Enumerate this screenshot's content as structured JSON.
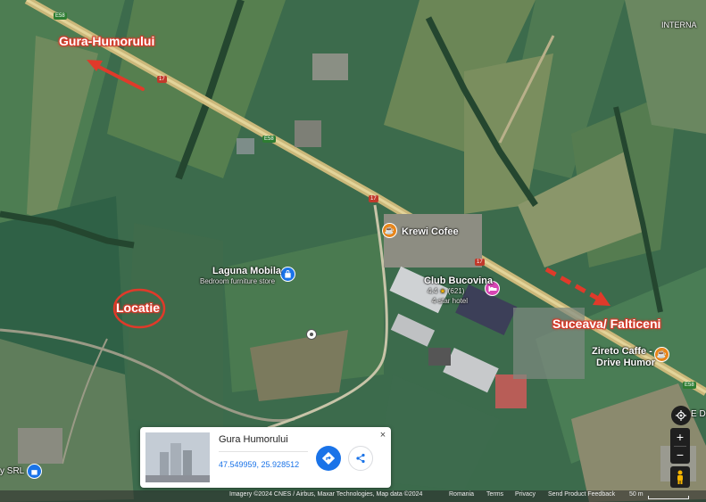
{
  "map": {
    "place_labels": {
      "top_right_cut": "INTERNA",
      "right_cut": "E D",
      "bottom_left_cut": "y SRL"
    },
    "road_labels": {
      "e58_a": "E58",
      "e58_b": "E58",
      "e58_c": "E58",
      "r17_a": "17",
      "r17_b": "17",
      "r17_c": "17"
    },
    "pois": [
      {
        "name": "Krewi Cofee",
        "subtitle": "",
        "icon": "coffee-icon",
        "color": "#e8851a"
      },
      {
        "name": "Laguna Mobila",
        "subtitle": "Bedroom furniture store",
        "icon": "shopping-bag-icon",
        "color": "#1a73e8"
      },
      {
        "name": "Club Bucovina",
        "rating": "4.4",
        "stars": "★",
        "reviews": "(621)",
        "subtitle": "4-star hotel",
        "icon": "bed-icon",
        "color": "#d645b3"
      },
      {
        "name": "Zireto Caffe - Drive Humor",
        "line1": "Zireto Caffe -",
        "line2": "Drive Humor",
        "icon": "coffee-icon",
        "color": "#e8851a"
      }
    ],
    "annotations": {
      "left_city": "Gura-Humorului",
      "right_city": "Suceava/ Falticeni",
      "location": "Locatie"
    },
    "accent_red": "#d43a2a"
  },
  "info_card": {
    "title": "Gura Humorului",
    "coords": "47.549959, 25.928512",
    "close_glyph": "×"
  },
  "controls": {
    "zoom_in": "+",
    "zoom_out": "−"
  },
  "attribution": {
    "imagery": "Imagery ©2024 CNES / Airbus, Maxar Technologies, Map data ©2024",
    "country": "Romania",
    "terms": "Terms",
    "privacy": "Privacy",
    "feedback": "Send Product Feedback",
    "scale": "50 m"
  }
}
